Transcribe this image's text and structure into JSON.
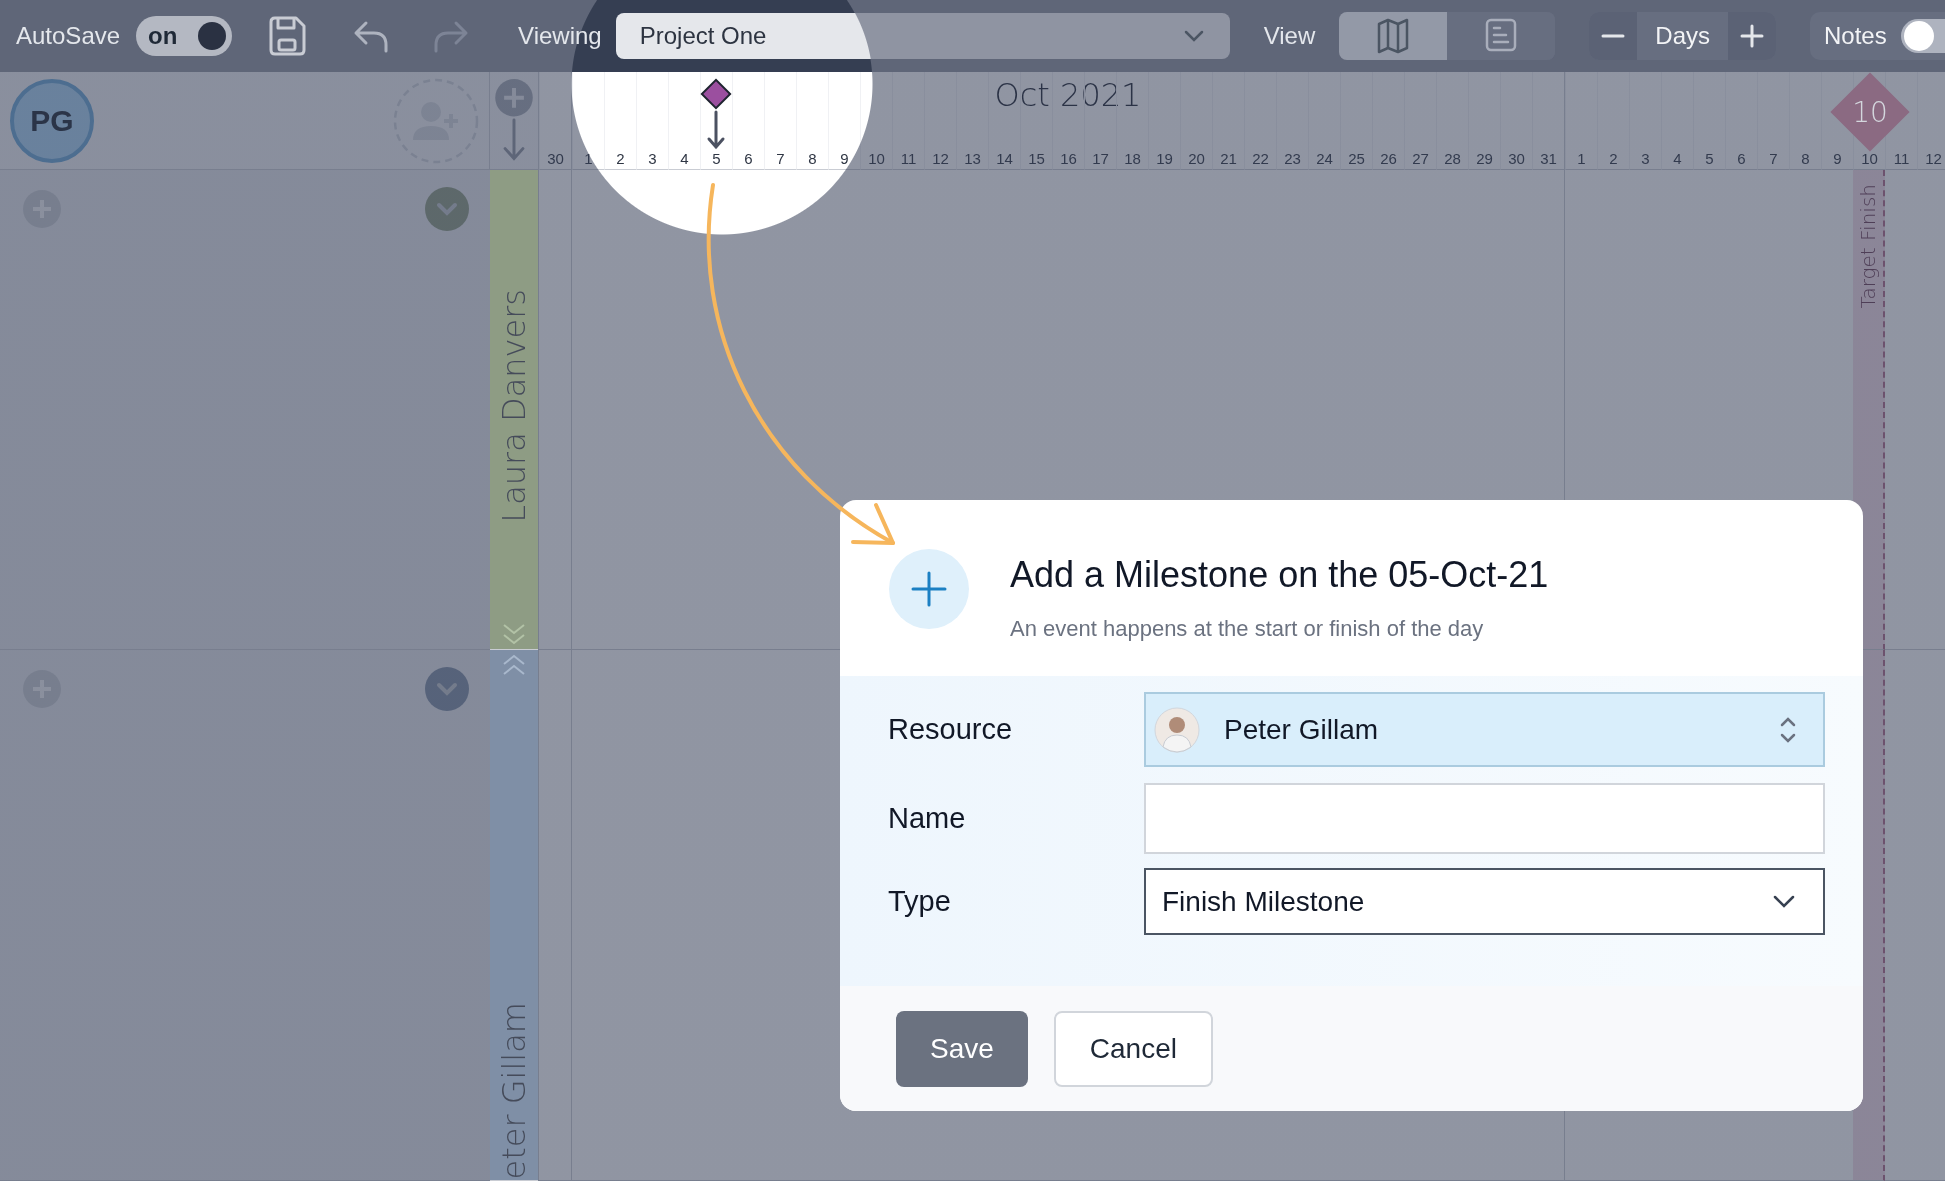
{
  "toolbar": {
    "autosave_label": "AutoSave",
    "autosave_toggle": {
      "label": "on",
      "on": true
    },
    "history": [
      {
        "kind": "undo",
        "disabled": false
      },
      {
        "kind": "redo",
        "disabled": true
      }
    ],
    "viewing_label": "Viewing",
    "project_select": {
      "value": "Project One"
    },
    "view_label": "View",
    "view_modes": [
      {
        "kind": "map",
        "selected": true
      },
      {
        "kind": "list",
        "selected": false
      }
    ],
    "zoom": {
      "label": "Days"
    },
    "notes_toggle": {
      "label": "Notes",
      "on": false
    }
  },
  "header": {
    "avatar": "PG"
  },
  "lanes": [
    {
      "name": "Laura Danvers",
      "color": "#8e9c84"
    },
    {
      "name": "eter Gillam",
      "color": "#7f8fa6"
    }
  ],
  "months": [
    {
      "days": [
        {
          "label": "30",
          "marker": false,
          "target": false
        }
      ]
    },
    {
      "name": "Oct 2021",
      "days": [
        {
          "label": "1",
          "marker": false,
          "target": false
        },
        {
          "label": "2",
          "marker": false,
          "target": false
        },
        {
          "label": "3",
          "marker": false,
          "target": false
        },
        {
          "label": "4",
          "marker": false,
          "target": false
        },
        {
          "label": "5",
          "marker": true,
          "target": false
        },
        {
          "label": "6",
          "marker": false,
          "target": false
        },
        {
          "label": "7",
          "marker": false,
          "target": false
        },
        {
          "label": "8",
          "marker": false,
          "target": false
        },
        {
          "label": "9",
          "marker": false,
          "target": false
        },
        {
          "label": "10",
          "marker": false,
          "target": false
        },
        {
          "label": "11",
          "marker": false,
          "target": false
        },
        {
          "label": "12",
          "marker": false,
          "target": false
        },
        {
          "label": "13",
          "marker": false,
          "target": false
        },
        {
          "label": "14",
          "marker": false,
          "target": false
        },
        {
          "label": "15",
          "marker": false,
          "target": false
        },
        {
          "label": "16",
          "marker": false,
          "target": false
        },
        {
          "label": "17",
          "marker": false,
          "target": false
        },
        {
          "label": "18",
          "marker": false,
          "target": false
        },
        {
          "label": "19",
          "marker": false,
          "target": false
        },
        {
          "label": "20",
          "marker": false,
          "target": false
        },
        {
          "label": "21",
          "marker": false,
          "target": false
        },
        {
          "label": "22",
          "marker": false,
          "target": false
        },
        {
          "label": "23",
          "marker": false,
          "target": false
        },
        {
          "label": "24",
          "marker": false,
          "target": false
        },
        {
          "label": "25",
          "marker": false,
          "target": false
        },
        {
          "label": "26",
          "marker": false,
          "target": false
        },
        {
          "label": "27",
          "marker": false,
          "target": false
        },
        {
          "label": "28",
          "marker": false,
          "target": false
        },
        {
          "label": "29",
          "marker": false,
          "target": false
        },
        {
          "label": "30",
          "marker": false,
          "target": false
        },
        {
          "label": "31",
          "marker": false,
          "target": false
        }
      ]
    },
    {
      "days": [
        {
          "label": "1",
          "marker": false,
          "target": false
        },
        {
          "label": "2",
          "marker": false,
          "target": false
        },
        {
          "label": "3",
          "marker": false,
          "target": false
        },
        {
          "label": "4",
          "marker": false,
          "target": false
        },
        {
          "label": "5",
          "marker": false,
          "target": false
        },
        {
          "label": "6",
          "marker": false,
          "target": false
        },
        {
          "label": "7",
          "marker": false,
          "target": false
        },
        {
          "label": "8",
          "marker": false,
          "target": false
        },
        {
          "label": "9",
          "marker": false,
          "target": false
        },
        {
          "label": "10",
          "marker": false,
          "target": true
        },
        {
          "label": "11",
          "marker": false,
          "target": false
        },
        {
          "label": "12",
          "marker": false,
          "target": false
        }
      ]
    }
  ],
  "target": {
    "label": "10",
    "caption": "Target Finish"
  },
  "dialog": {
    "title": "Add a Milestone on the 05-Oct-21",
    "subtitle": "An event happens at the start or finish of the day",
    "fields": [
      {
        "kind": "resource",
        "label": "Resource",
        "value": "Peter Gillam"
      },
      {
        "kind": "text",
        "label": "Name"
      },
      {
        "kind": "select",
        "label": "Type",
        "value": "Finish Milestone"
      }
    ],
    "buttons": [
      {
        "kind": "primary",
        "label": "Save"
      },
      {
        "kind": "secondary",
        "label": "Cancel"
      }
    ]
  }
}
